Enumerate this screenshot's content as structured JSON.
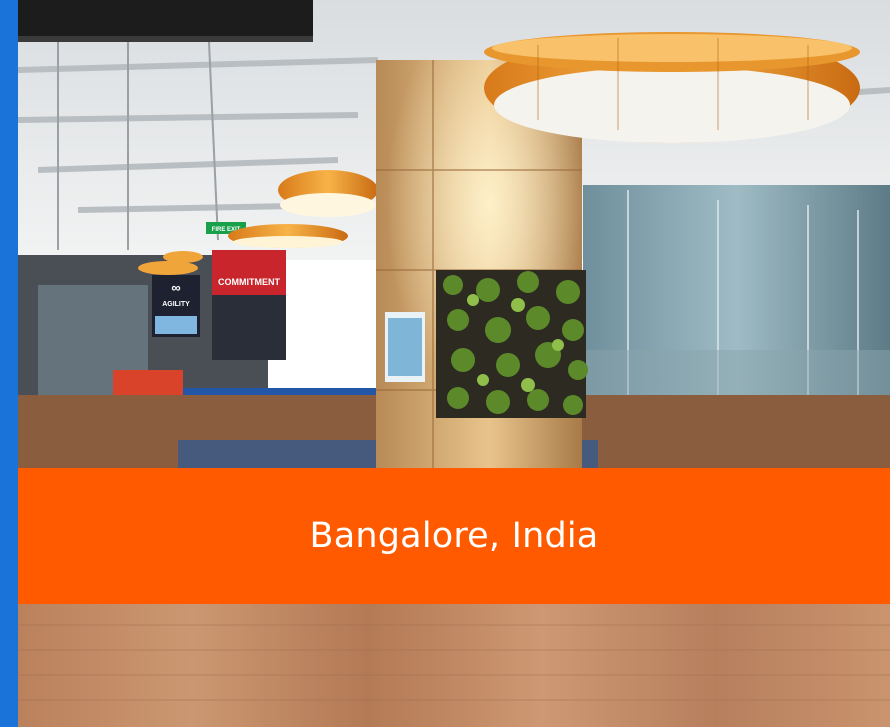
{
  "caption": {
    "location": "Bangalore, India"
  },
  "signs": {
    "fire_exit": "FIRE EXIT",
    "commitment": "COMMITMENT",
    "agility": "AGILITY"
  },
  "colors": {
    "accent_blue": "#1a73d9",
    "caption_orange": "#ff5a00",
    "caption_text": "#ffffff"
  }
}
